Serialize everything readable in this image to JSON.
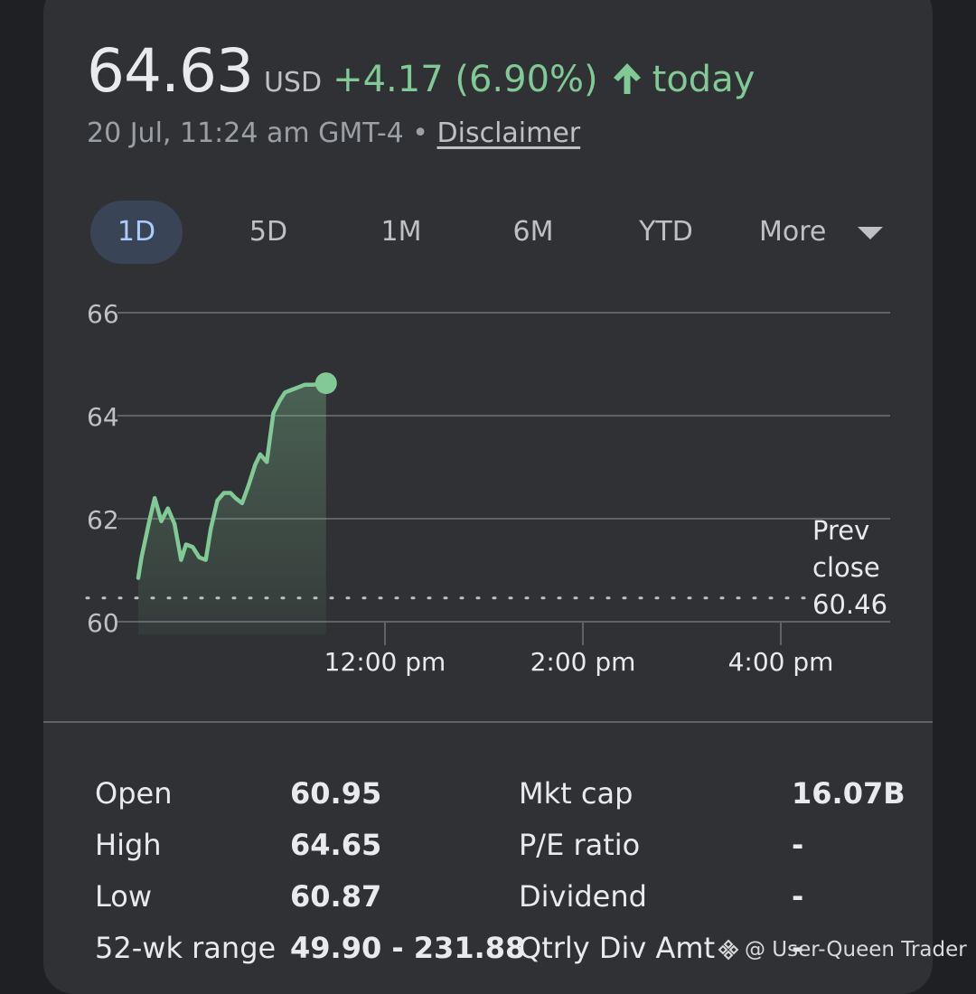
{
  "quote": {
    "price": "64.63",
    "currency": "USD",
    "change": "+4.17 (6.90%)",
    "period": "today",
    "timestamp": "20 Jul, 11:24 am GMT-4 •",
    "disclaimer": "Disclaimer",
    "up_color": "#81c995"
  },
  "ranges": [
    {
      "label": "1D",
      "active": true
    },
    {
      "label": "5D",
      "active": false
    },
    {
      "label": "1M",
      "active": false
    },
    {
      "label": "6M",
      "active": false
    },
    {
      "label": "YTD",
      "active": false
    }
  ],
  "more_label": "More",
  "chart_data": {
    "type": "line",
    "y_ticks": [
      "60",
      "62",
      "64",
      "66"
    ],
    "x_ticks": [
      "12:00 pm",
      "2:00 pm",
      "4:00 pm"
    ],
    "ylim": [
      60,
      66
    ],
    "xlim": [
      "09:30",
      "16:00"
    ],
    "prev_close": 60.46,
    "prev_close_label": [
      "Prev",
      "close",
      "60.46"
    ],
    "series": [
      {
        "x": [
          "09:30",
          "09:32",
          "09:37",
          "09:40",
          "09:44",
          "09:48",
          "09:52",
          "09:56",
          "09:59",
          "10:03",
          "10:07",
          "10:11",
          "10:14",
          "10:18",
          "10:22",
          "10:26",
          "10:29",
          "10:33",
          "10:37",
          "10:41",
          "10:44",
          "10:48",
          "10:52",
          "10:56",
          "10:59",
          "11:03",
          "11:07",
          "11:11",
          "11:16",
          "11:20",
          "11:24"
        ],
        "values": [
          60.85,
          61.25,
          62.0,
          62.4,
          61.95,
          62.2,
          61.9,
          61.2,
          61.5,
          61.45,
          61.25,
          61.2,
          61.8,
          62.35,
          62.5,
          62.5,
          62.4,
          62.3,
          62.65,
          63.05,
          63.25,
          63.1,
          64.05,
          64.3,
          64.45,
          64.5,
          64.55,
          64.6,
          64.6,
          64.62,
          64.63
        ],
        "color": "#81c995"
      }
    ],
    "grid": true
  },
  "stats": [
    {
      "label": "Open",
      "value": "60.95"
    },
    {
      "label": "High",
      "value": "64.65"
    },
    {
      "label": "Low",
      "value": "60.87"
    },
    {
      "label": "52-wk range",
      "value": "49.90 - 231.88"
    },
    {
      "label": "Mkt cap",
      "value": "16.07B"
    },
    {
      "label": "P/E ratio",
      "value": "-"
    },
    {
      "label": "Dividend",
      "value": "-"
    },
    {
      "label": "Qtrly Div Amt",
      "value": "-"
    }
  ],
  "watermark": "@ User-Queen Trader",
  "icons": [
    "arrow-up-icon",
    "chevron-down-icon",
    "binance-logo-icon"
  ]
}
